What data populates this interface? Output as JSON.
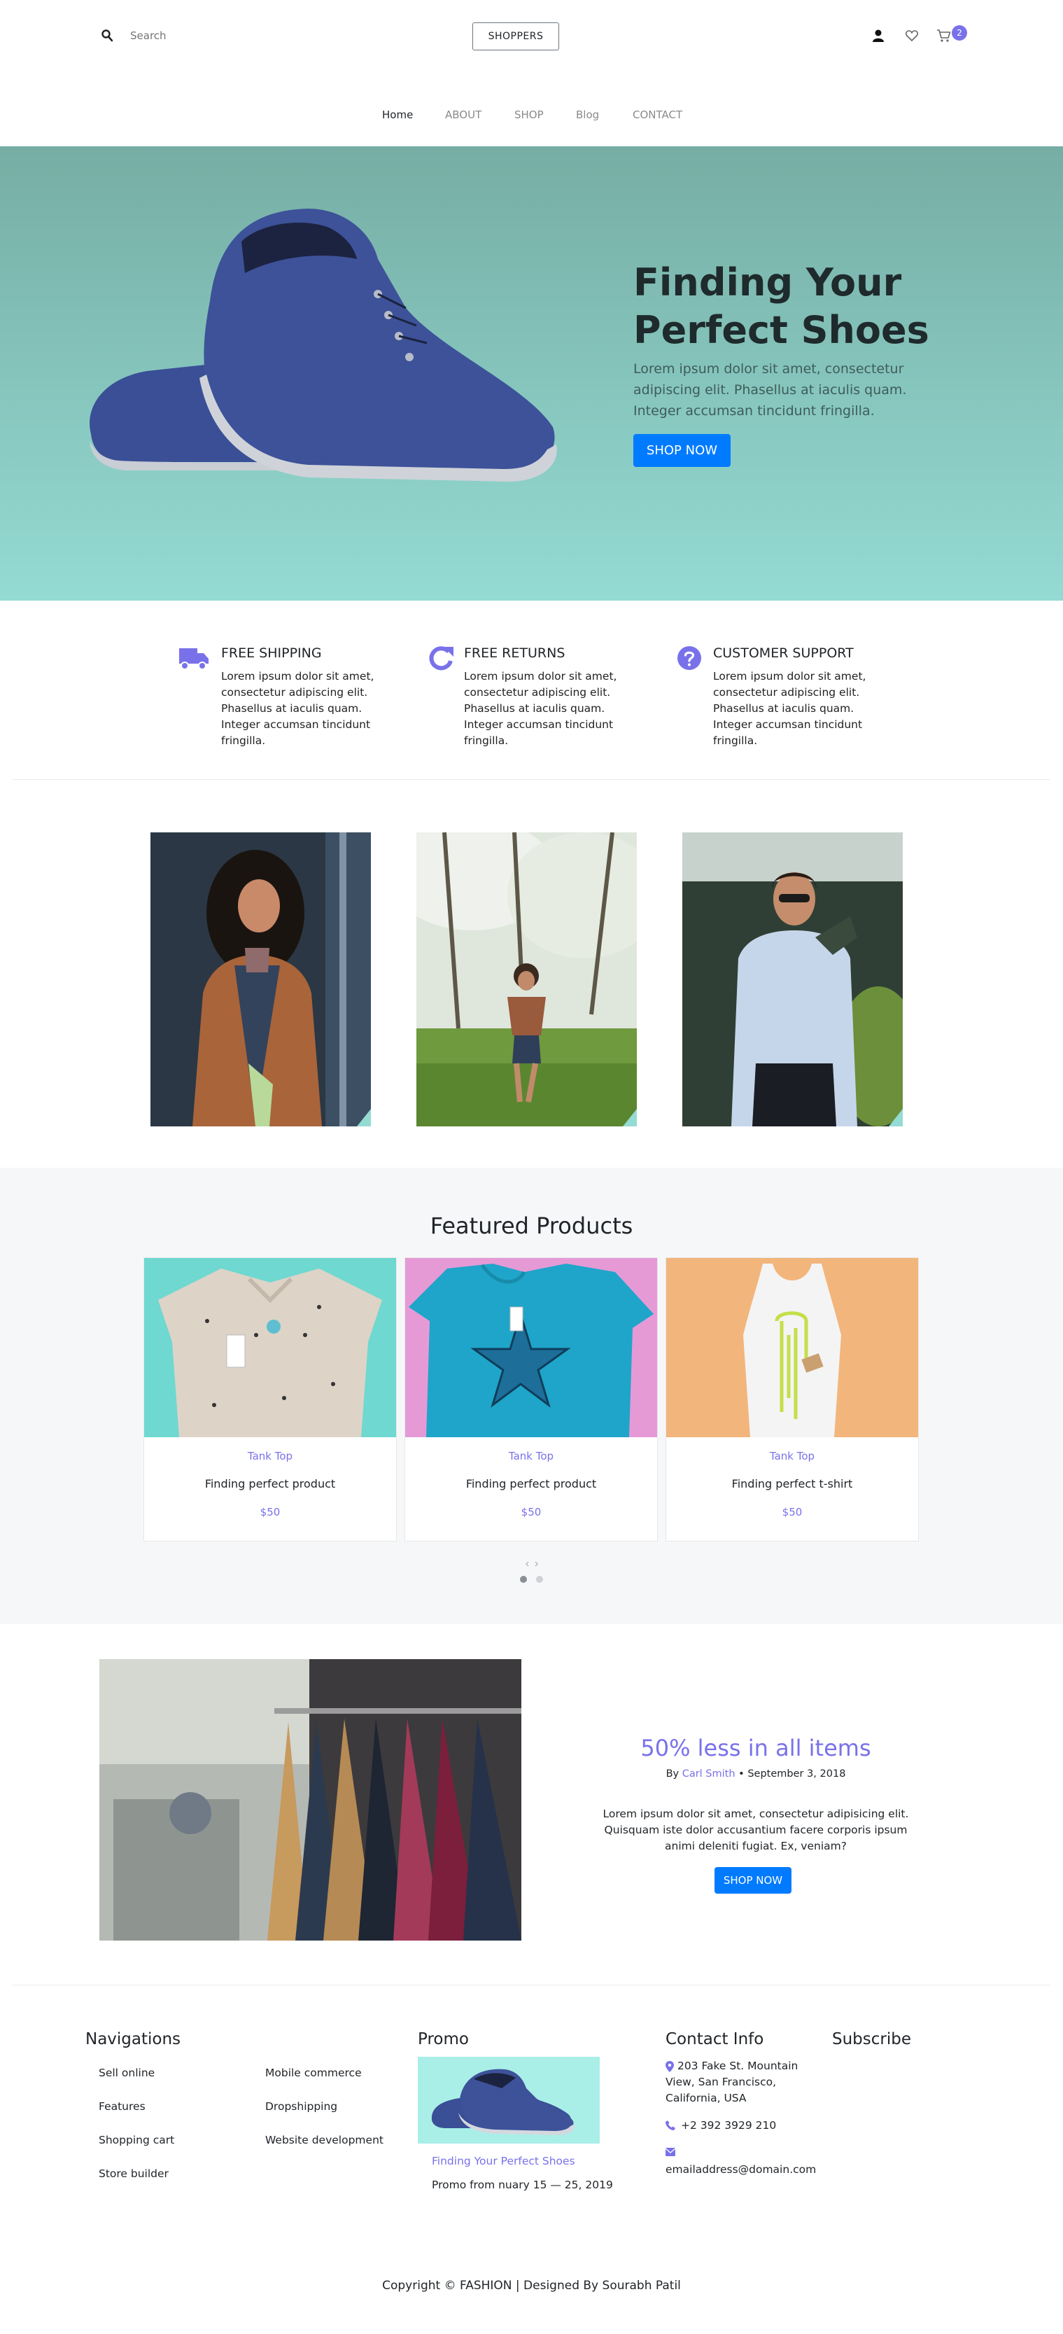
{
  "header": {
    "search_placeholder": "Search",
    "logo": "SHOPPERS",
    "cart_count": "2"
  },
  "nav": [
    {
      "label": "Home"
    },
    {
      "label": "ABOUT"
    },
    {
      "label": "SHOP"
    },
    {
      "label": "Blog"
    },
    {
      "label": "CONTACT"
    }
  ],
  "hero": {
    "title_line1": "Finding Your",
    "title_line2": "Perfect Shoes",
    "text": "Lorem ipsum dolor sit amet, consectetur adipiscing elit. Phasellus at iaculis quam. Integer accumsan tincidunt fringilla.",
    "button": "SHOP NOW"
  },
  "features": [
    {
      "icon": "truck-icon",
      "title": "FREE SHIPPING",
      "text": "Lorem ipsum dolor sit amet, consectetur adipiscing elit. Phasellus at iaculis quam. Integer accumsan tincidunt fringilla."
    },
    {
      "icon": "refresh-icon",
      "title": "FREE RETURNS",
      "text": "Lorem ipsum dolor sit amet, consectetur adipiscing elit. Phasellus at iaculis quam. Integer accumsan tincidunt fringilla."
    },
    {
      "icon": "help-circle-icon",
      "title": "CUSTOMER SUPPORT",
      "text": "Lorem ipsum dolor sit amet, consectetur adipiscing elit. Phasellus at iaculis quam. Integer accumsan tincidunt fringilla."
    }
  ],
  "featured": {
    "title": "Featured Products",
    "products": [
      {
        "category": "Tank Top",
        "name": "Finding perfect product",
        "price": "$50"
      },
      {
        "category": "Tank Top",
        "name": "Finding perfect product",
        "price": "$50"
      },
      {
        "category": "Tank Top",
        "name": "Finding perfect t-shirt",
        "price": "$50"
      }
    ]
  },
  "promo": {
    "title": "50% less in all items",
    "by": "By",
    "author": "Carl Smith",
    "date": "• September 3, 2018",
    "text": "Lorem ipsum dolor sit amet, consectetur adipisicing elit. Quisquam iste dolor accusantium facere corporis ipsum animi deleniti fugiat. Ex, veniam?",
    "button": "SHOP NOW"
  },
  "footer": {
    "nav_title": "Navigations",
    "nav_col1": [
      "Sell online",
      "Features",
      "Shopping cart",
      "Store builder"
    ],
    "nav_col2": [
      "Mobile commerce",
      "Dropshipping",
      "Website development"
    ],
    "promo_title": "Promo",
    "promo_link": "Finding Your Perfect Shoes",
    "promo_date": "Promo from nuary 15 — 25, 2019",
    "contact_title": "Contact Info",
    "address_line1": "203 Fake St. Mountain",
    "address_line2": "View, San Francisco,",
    "address_line3": "California, USA",
    "phone": "+2 392 3929 210",
    "email": "emailaddress@domain.com",
    "subscribe_title": "Subscribe",
    "copyright": "Copyright © FASHION | Designed By Sourabh Patil"
  },
  "colors": {
    "accent": "#7971ea",
    "button_blue": "#007bff",
    "hero_top": "#76ada4",
    "hero_bottom": "#94dbd3",
    "featured_bg": "#f6f7f9"
  }
}
